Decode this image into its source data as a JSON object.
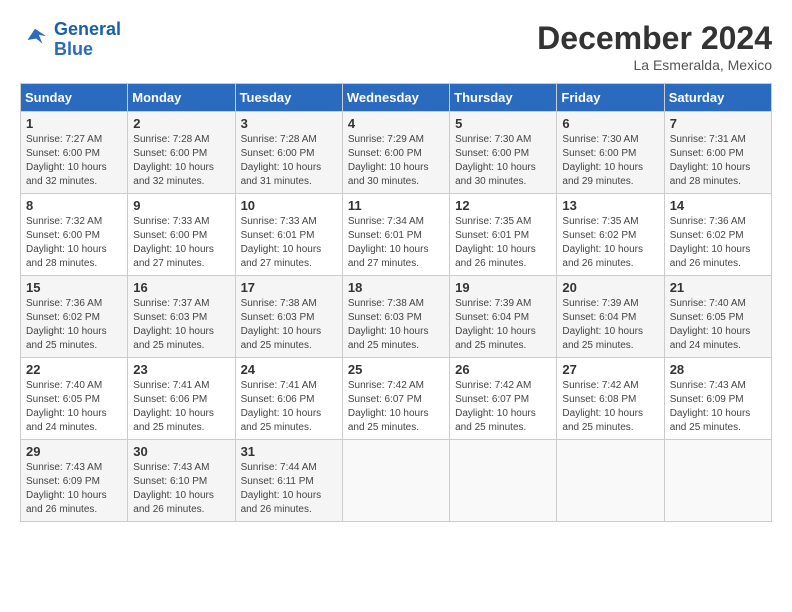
{
  "header": {
    "logo_line1": "General",
    "logo_line2": "Blue",
    "month": "December 2024",
    "location": "La Esmeralda, Mexico"
  },
  "days_of_week": [
    "Sunday",
    "Monday",
    "Tuesday",
    "Wednesday",
    "Thursday",
    "Friday",
    "Saturday"
  ],
  "weeks": [
    [
      {
        "day": "1",
        "sunrise": "Sunrise: 7:27 AM",
        "sunset": "Sunset: 6:00 PM",
        "daylight": "Daylight: 10 hours and 32 minutes."
      },
      {
        "day": "2",
        "sunrise": "Sunrise: 7:28 AM",
        "sunset": "Sunset: 6:00 PM",
        "daylight": "Daylight: 10 hours and 32 minutes."
      },
      {
        "day": "3",
        "sunrise": "Sunrise: 7:28 AM",
        "sunset": "Sunset: 6:00 PM",
        "daylight": "Daylight: 10 hours and 31 minutes."
      },
      {
        "day": "4",
        "sunrise": "Sunrise: 7:29 AM",
        "sunset": "Sunset: 6:00 PM",
        "daylight": "Daylight: 10 hours and 30 minutes."
      },
      {
        "day": "5",
        "sunrise": "Sunrise: 7:30 AM",
        "sunset": "Sunset: 6:00 PM",
        "daylight": "Daylight: 10 hours and 30 minutes."
      },
      {
        "day": "6",
        "sunrise": "Sunrise: 7:30 AM",
        "sunset": "Sunset: 6:00 PM",
        "daylight": "Daylight: 10 hours and 29 minutes."
      },
      {
        "day": "7",
        "sunrise": "Sunrise: 7:31 AM",
        "sunset": "Sunset: 6:00 PM",
        "daylight": "Daylight: 10 hours and 28 minutes."
      }
    ],
    [
      {
        "day": "8",
        "sunrise": "Sunrise: 7:32 AM",
        "sunset": "Sunset: 6:00 PM",
        "daylight": "Daylight: 10 hours and 28 minutes."
      },
      {
        "day": "9",
        "sunrise": "Sunrise: 7:33 AM",
        "sunset": "Sunset: 6:00 PM",
        "daylight": "Daylight: 10 hours and 27 minutes."
      },
      {
        "day": "10",
        "sunrise": "Sunrise: 7:33 AM",
        "sunset": "Sunset: 6:01 PM",
        "daylight": "Daylight: 10 hours and 27 minutes."
      },
      {
        "day": "11",
        "sunrise": "Sunrise: 7:34 AM",
        "sunset": "Sunset: 6:01 PM",
        "daylight": "Daylight: 10 hours and 27 minutes."
      },
      {
        "day": "12",
        "sunrise": "Sunrise: 7:35 AM",
        "sunset": "Sunset: 6:01 PM",
        "daylight": "Daylight: 10 hours and 26 minutes."
      },
      {
        "day": "13",
        "sunrise": "Sunrise: 7:35 AM",
        "sunset": "Sunset: 6:02 PM",
        "daylight": "Daylight: 10 hours and 26 minutes."
      },
      {
        "day": "14",
        "sunrise": "Sunrise: 7:36 AM",
        "sunset": "Sunset: 6:02 PM",
        "daylight": "Daylight: 10 hours and 26 minutes."
      }
    ],
    [
      {
        "day": "15",
        "sunrise": "Sunrise: 7:36 AM",
        "sunset": "Sunset: 6:02 PM",
        "daylight": "Daylight: 10 hours and 25 minutes."
      },
      {
        "day": "16",
        "sunrise": "Sunrise: 7:37 AM",
        "sunset": "Sunset: 6:03 PM",
        "daylight": "Daylight: 10 hours and 25 minutes."
      },
      {
        "day": "17",
        "sunrise": "Sunrise: 7:38 AM",
        "sunset": "Sunset: 6:03 PM",
        "daylight": "Daylight: 10 hours and 25 minutes."
      },
      {
        "day": "18",
        "sunrise": "Sunrise: 7:38 AM",
        "sunset": "Sunset: 6:03 PM",
        "daylight": "Daylight: 10 hours and 25 minutes."
      },
      {
        "day": "19",
        "sunrise": "Sunrise: 7:39 AM",
        "sunset": "Sunset: 6:04 PM",
        "daylight": "Daylight: 10 hours and 25 minutes."
      },
      {
        "day": "20",
        "sunrise": "Sunrise: 7:39 AM",
        "sunset": "Sunset: 6:04 PM",
        "daylight": "Daylight: 10 hours and 25 minutes."
      },
      {
        "day": "21",
        "sunrise": "Sunrise: 7:40 AM",
        "sunset": "Sunset: 6:05 PM",
        "daylight": "Daylight: 10 hours and 24 minutes."
      }
    ],
    [
      {
        "day": "22",
        "sunrise": "Sunrise: 7:40 AM",
        "sunset": "Sunset: 6:05 PM",
        "daylight": "Daylight: 10 hours and 24 minutes."
      },
      {
        "day": "23",
        "sunrise": "Sunrise: 7:41 AM",
        "sunset": "Sunset: 6:06 PM",
        "daylight": "Daylight: 10 hours and 25 minutes."
      },
      {
        "day": "24",
        "sunrise": "Sunrise: 7:41 AM",
        "sunset": "Sunset: 6:06 PM",
        "daylight": "Daylight: 10 hours and 25 minutes."
      },
      {
        "day": "25",
        "sunrise": "Sunrise: 7:42 AM",
        "sunset": "Sunset: 6:07 PM",
        "daylight": "Daylight: 10 hours and 25 minutes."
      },
      {
        "day": "26",
        "sunrise": "Sunrise: 7:42 AM",
        "sunset": "Sunset: 6:07 PM",
        "daylight": "Daylight: 10 hours and 25 minutes."
      },
      {
        "day": "27",
        "sunrise": "Sunrise: 7:42 AM",
        "sunset": "Sunset: 6:08 PM",
        "daylight": "Daylight: 10 hours and 25 minutes."
      },
      {
        "day": "28",
        "sunrise": "Sunrise: 7:43 AM",
        "sunset": "Sunset: 6:09 PM",
        "daylight": "Daylight: 10 hours and 25 minutes."
      }
    ],
    [
      {
        "day": "29",
        "sunrise": "Sunrise: 7:43 AM",
        "sunset": "Sunset: 6:09 PM",
        "daylight": "Daylight: 10 hours and 26 minutes."
      },
      {
        "day": "30",
        "sunrise": "Sunrise: 7:43 AM",
        "sunset": "Sunset: 6:10 PM",
        "daylight": "Daylight: 10 hours and 26 minutes."
      },
      {
        "day": "31",
        "sunrise": "Sunrise: 7:44 AM",
        "sunset": "Sunset: 6:11 PM",
        "daylight": "Daylight: 10 hours and 26 minutes."
      },
      null,
      null,
      null,
      null
    ]
  ]
}
